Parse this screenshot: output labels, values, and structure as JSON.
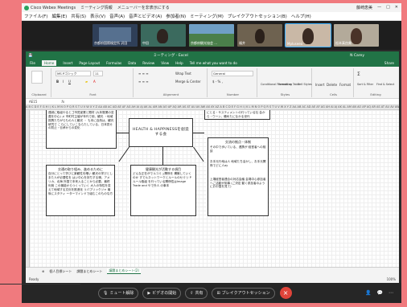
{
  "webex": {
    "title": "Cisco Webex Meetings",
    "subtitle": "ミーティング情報",
    "notice": "メニューバーを非表示にする",
    "host": "藤崎恵美",
    "menu": [
      "ファイル(F)",
      "編集(E)",
      "共有(S)",
      "表示(V)",
      "音声(A)",
      "音声とビデオ(A)",
      "参加者(N)",
      "ミーティング(M)",
      "ブレイクアウトセッション(B)",
      "ヘルプ(H)"
    ],
    "participants": [
      {
        "name": "京都府国際検定所 沢田",
        "color": "#3b4f6b"
      },
      {
        "name": "中田",
        "color": "#4a7a6b"
      },
      {
        "name": "京都府観光協会 ...",
        "color": "#5a8ab0"
      },
      {
        "name": "福井",
        "color": "#7a6a52"
      },
      {
        "name": "Mpluseeo",
        "color": "#b8a898"
      },
      {
        "name": "松本真由美",
        "color": "#a8a090"
      }
    ]
  },
  "excel": {
    "title": "ミーティング - Excel",
    "user": "N Carey",
    "tabs": [
      "File",
      "Home",
      "Insert",
      "Page Layout",
      "Formulas",
      "Data",
      "Review",
      "View",
      "Help",
      "Tell me what you want to do",
      "Share"
    ],
    "ribbon": {
      "clipboard": "Clipboard",
      "font": "Font",
      "font_name": "MS Pゴシック",
      "font_size": "11",
      "alignment": "Alignment",
      "wrap": "Wrap Text",
      "merge": "Merge & Center",
      "number": "Number",
      "number_format": "General",
      "styles": "Styles",
      "cond_format": "Conditional Formatting",
      "format_table": "Format as Table",
      "cell_styles": "Cell Styles",
      "cells": "Cells",
      "insert": "Insert",
      "delete": "Delete",
      "format": "Format",
      "editing": "Editing",
      "sort": "Sort & Filter",
      "find": "Find & Select"
    },
    "cell_ref": "AE15",
    "fx": "fx",
    "boxes": {
      "top_left": "連続に取組やるとゴ市見室業と題材 (九年販業の変遷を中心) メ 市町村主催が年代で用、観光 ・地域振興たちがらもの人と観光 ・ も本に自然は、観光研究で こらにしていこならたしている、日本見せの防止・伝承からの変化",
      "center": "HEALTH & HAPPINESSを創造する会",
      "top_right": "にとる・サスティメントの行っている社 会から・ウーン、頼めたになかる世代",
      "mid_left_head": "交通の取り組み、進めるために",
      "mid_left": "自分にとって学びに楽観性を確い 観光の学びとしまた人が必要性を はい中心を持ちする様。アメリカ、北海 外国で本来入ることから必要。最終 利用 この機能からつくっていく 大人の特性を変えて地域する文化を推進化 リパブリックジャ 最後にスタティ ーターマインドで組むこのものな方",
      "mid_center_head": "健康観光が活動する項目",
      "mid_center": "どんな正在がでルコミュ関係を 構築していくのか すでルネットワークとルールのセミリ Pルール取組 を行っている関係性はImage Trade and やで外人 の事本",
      "mid_right_head": "交流の拠点・体制",
      "mid_right_a": "その中で歩いている、連携が 経営者への相談",
      "mid_right_b": "お手元行地は人 地域たち活かし、お手元関係でどに人ay",
      "mid_right_c": "上場経営者連合の対応会議 会場中心参加者へご活動が用事 (ご決定 動く参加者のようにお中国を見て)"
    },
    "sheet_tabs": [
      "個人目標シート",
      "課題まとめシート",
      "議題まとめシート(2)"
    ],
    "active_tab": 2,
    "status": "Ready",
    "zoom": "100%"
  },
  "controls": {
    "mute": "ミュート解除",
    "video": "ビデオの開始",
    "share": "共有",
    "breakout": "ブレイクアウトセッション",
    "leave": "×"
  }
}
